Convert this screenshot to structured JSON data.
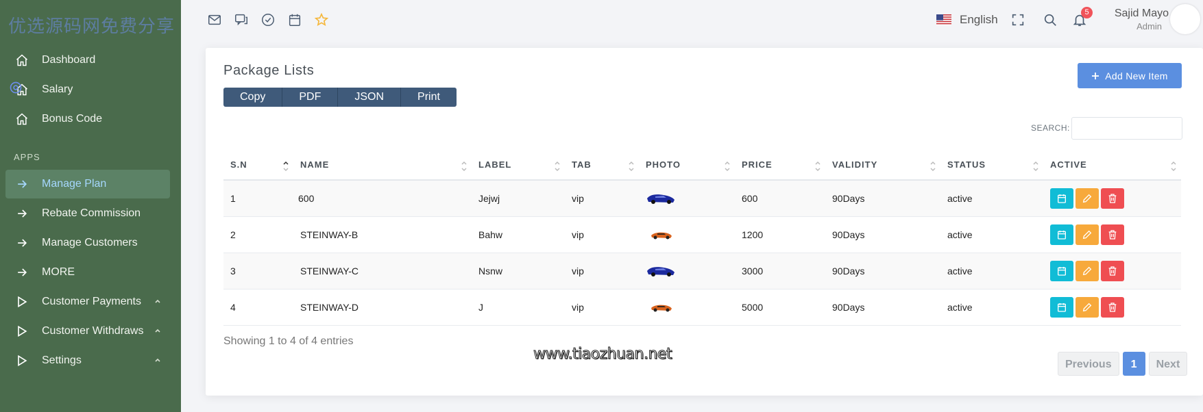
{
  "watermark_top": "优选源码网免费分享",
  "watermark_bottom": "www.tiaozhuan.net",
  "sidebar": {
    "items_top": [
      {
        "label": "Dashboard",
        "icon": "home-icon"
      },
      {
        "label": "Salary",
        "icon": "home-icon"
      },
      {
        "label": "Bonus Code",
        "icon": "home-icon"
      }
    ],
    "apps_heading": "APPS",
    "items_apps": [
      {
        "label": "Manage Plan",
        "icon": "arrow-right-icon",
        "active": true
      },
      {
        "label": "Rebate Commission",
        "icon": "arrow-right-icon"
      },
      {
        "label": "Manage Customers",
        "icon": "arrow-right-icon"
      },
      {
        "label": "MORE",
        "icon": "arrow-right-icon"
      },
      {
        "label": "Customer Payments",
        "icon": "play-outline-icon",
        "caret": true
      },
      {
        "label": "Customer Withdraws",
        "icon": "play-outline-icon",
        "caret": true
      },
      {
        "label": "Settings",
        "icon": "play-outline-icon",
        "caret": true
      }
    ]
  },
  "topbar": {
    "icons": [
      "mail-icon",
      "chat-icon",
      "check-circle-icon",
      "calendar-icon",
      "star-icon"
    ],
    "language": "English",
    "notifications_count": "5",
    "user_name": "Sajid Mayo",
    "user_role": "Admin"
  },
  "card": {
    "title": "Package Lists",
    "export_buttons": [
      "Copy",
      "PDF",
      "JSON",
      "Print"
    ],
    "add_button": "Add New Item",
    "search_label": "SEARCH:",
    "search_value": "",
    "columns": [
      "S.N",
      "NAME",
      "LABEL",
      "TAB",
      "PHOTO",
      "PRICE",
      "VALIDITY",
      "STATUS",
      "ACTIVE"
    ],
    "rows": [
      {
        "sn": "1",
        "name": "600",
        "label": "Jejwj",
        "tab": "vip",
        "photo": "car-blue",
        "price": "600",
        "validity": "90Days",
        "status": "active"
      },
      {
        "sn": "2",
        "name": "STEINWAY-B",
        "label": "Bahw",
        "tab": "vip",
        "photo": "car-orange",
        "price": "1200",
        "validity": "90Days",
        "status": "active"
      },
      {
        "sn": "3",
        "name": "STEINWAY-C",
        "label": "Nsnw",
        "tab": "vip",
        "photo": "car-blue",
        "price": "3000",
        "validity": "90Days",
        "status": "active"
      },
      {
        "sn": "4",
        "name": "STEINWAY-D",
        "label": "J",
        "tab": "vip",
        "photo": "car-orange",
        "price": "5000",
        "validity": "90Days",
        "status": "active"
      }
    ],
    "info": "Showing 1 to 4 of 4 entries",
    "pager": {
      "prev": "Previous",
      "current": "1",
      "next": "Next"
    }
  },
  "colors": {
    "sidebar": "#4a6b4c",
    "primary": "#5b8fe0",
    "info": "#11bcd6",
    "warning": "#f7a93b",
    "danger": "#ef4e52"
  }
}
